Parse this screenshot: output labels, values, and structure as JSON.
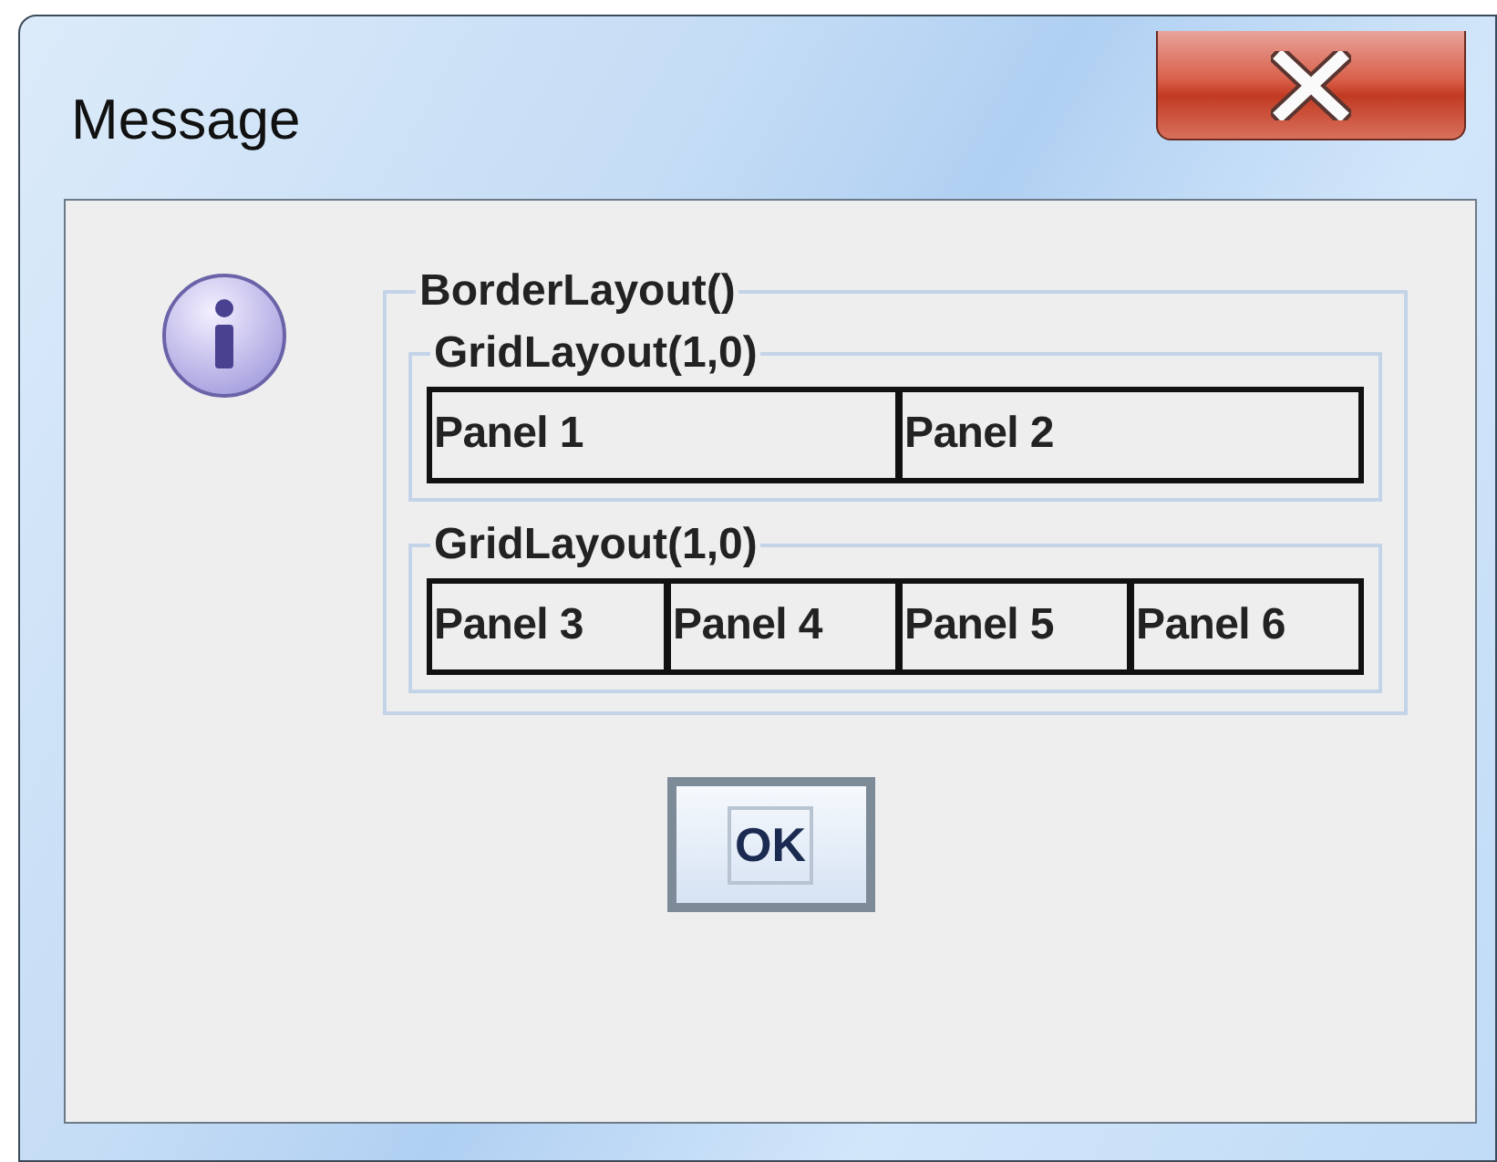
{
  "window": {
    "title": "Message"
  },
  "outer_group": {
    "title": "BorderLayout()",
    "groups": [
      {
        "title": "GridLayout(1,0)",
        "panels": [
          "Panel 1",
          "Panel 2"
        ]
      },
      {
        "title": "GridLayout(1,0)",
        "panels": [
          "Panel 3",
          "Panel 4",
          "Panel 5",
          "Panel 6"
        ]
      }
    ]
  },
  "buttons": [
    {
      "label": "OK",
      "selected": true
    }
  ]
}
